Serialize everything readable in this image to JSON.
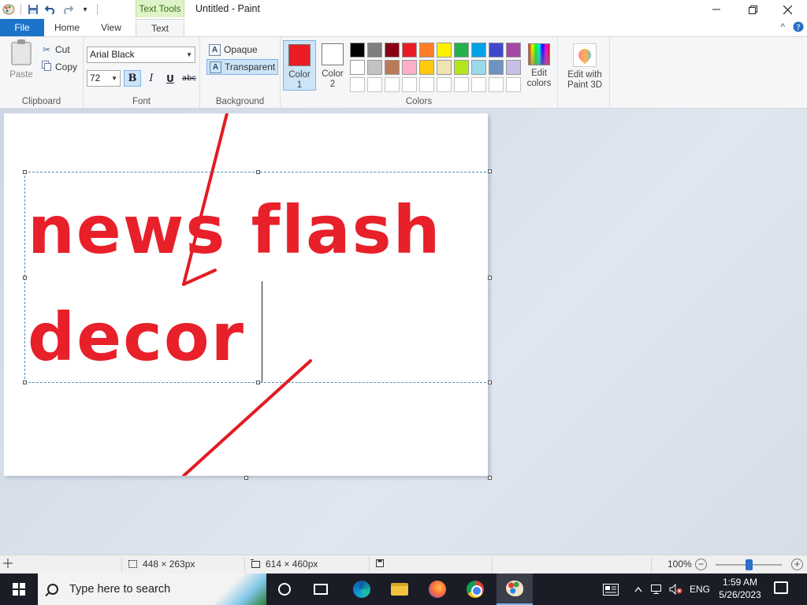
{
  "app": {
    "window_title": "Untitled - Paint",
    "context_tab_group": "Text Tools"
  },
  "tabs": {
    "file": "File",
    "home": "Home",
    "view": "View",
    "text": "Text"
  },
  "clipboard": {
    "paste": "Paste",
    "cut": "Cut",
    "copy": "Copy",
    "group_label": "Clipboard"
  },
  "font": {
    "family": "Arial Black",
    "size": "72",
    "bold": "B",
    "italic": "I",
    "underline": "U",
    "strikethrough": "abc",
    "group_label": "Font"
  },
  "background": {
    "opaque": "Opaque",
    "transparent": "Transparent",
    "group_label": "Background"
  },
  "colors": {
    "color1_label": "Color 1",
    "color2_label": "Color 2",
    "color1": "#ed1c24",
    "color2": "#ffffff",
    "edit_colors": "Edit colors",
    "group_label": "Colors",
    "palette_row1": [
      "#000000",
      "#7f7f7f",
      "#880015",
      "#ed1c24",
      "#ff7f27",
      "#fff200",
      "#22b14c",
      "#00a2e8",
      "#3f48cc",
      "#a349a4"
    ],
    "palette_row2": [
      "#ffffff",
      "#c3c3c3",
      "#b97a57",
      "#ffaec9",
      "#ffc90e",
      "#efe4b0",
      "#b5e61d",
      "#99d9ea",
      "#7092be",
      "#c8bfe7"
    ]
  },
  "paint3d": {
    "label": "Edit with Paint 3D"
  },
  "canvas": {
    "text_line1": "news flash",
    "text_line2": "decor",
    "text_color": "#e8202a"
  },
  "status": {
    "selection_size": "448 × 263px",
    "canvas_size": "614 × 460px",
    "zoom": "100%"
  },
  "taskbar": {
    "search_placeholder": "Type here to search",
    "language": "ENG",
    "time": "1:59 AM",
    "date": "5/26/2023"
  }
}
